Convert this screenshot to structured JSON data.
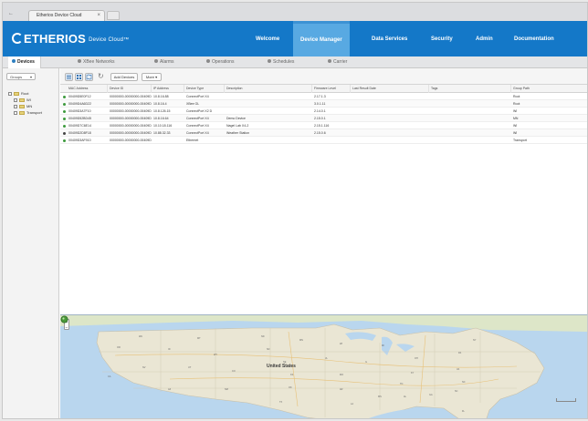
{
  "browser": {
    "tab_title": "Etherios Device Cloud",
    "tab_close": "×",
    "back_glyph": "←"
  },
  "header": {
    "brand": "ETHERIOS",
    "product": "Device Cloud",
    "trademark": "™",
    "nav": [
      {
        "label": "Welcome"
      },
      {
        "label": "Device Manager",
        "active": true
      },
      {
        "label": "Data Services"
      },
      {
        "label": "Security"
      },
      {
        "label": "Admin"
      },
      {
        "label": "Documentation"
      }
    ]
  },
  "subtabs": [
    {
      "label": "Devices",
      "active": true
    },
    {
      "label": "XBee Networks"
    },
    {
      "label": "Alarms"
    },
    {
      "label": "Operations"
    },
    {
      "label": "Schedules"
    },
    {
      "label": "Carrier"
    }
  ],
  "sidebar": {
    "group_select": "Groups",
    "tree": [
      {
        "label": "Root",
        "level": 0
      },
      {
        "label": "WI",
        "level": 1
      },
      {
        "label": "MN",
        "level": 1
      },
      {
        "label": "Transport",
        "level": 1
      }
    ]
  },
  "toolbar": {
    "add_devices": "Add Devices",
    "more": "More",
    "more_caret": "▾",
    "refresh_glyph": "↻"
  },
  "table": {
    "columns": [
      "MAC Address",
      "Device ID",
      "IP Address",
      "Device Type",
      "Description",
      "Firmware Level",
      "Last Result Date",
      "Tags",
      "Group Path"
    ],
    "rows": [
      {
        "status": "connected",
        "mac": "00409D5E0F12",
        "id": "00000000-00000000-00409DFF-FF5E0F12",
        "ip": "10.8.16.88",
        "type": "ConnectPort X4",
        "desc": "",
        "fw": "2.17.1.3",
        "last": "",
        "tags": "",
        "group": "Root"
      },
      {
        "status": "connected",
        "mac": "00409D4A6D22",
        "id": "00000000-00000000-00409DFF-FF4A6D22",
        "ip": "10.8.16.4",
        "type": "XBee GL",
        "desc": "",
        "fw": "3.0.1.11",
        "last": "",
        "tags": "",
        "group": "Root"
      },
      {
        "status": "connected",
        "mac": "00409D3A7F10",
        "id": "00000000-00000000-00409DFF-FF3A7F10",
        "ip": "10.8.126.15",
        "type": "ConnectPort X2 D",
        "desc": "",
        "fw": "2.14.0.1",
        "last": "",
        "tags": "",
        "group": "WI"
      },
      {
        "status": "connected",
        "mac": "00409D52BD45",
        "id": "00000000-00000000-00409DFF-FF52BD45",
        "ip": "10.8.16.64",
        "type": "ConnectPort X4",
        "desc": "Demo Device",
        "fw": "2.15.0.1",
        "last": "",
        "tags": "",
        "group": "MN"
      },
      {
        "status": "connected",
        "mac": "00409D7C6E14",
        "id": "00000000-00000000-00409DFF-FF7C6E14",
        "ip": "10.10.18.116",
        "type": "ConnectPort X4",
        "desc": "Nagel Lab X4-2",
        "fw": "2.15.1.116",
        "last": "",
        "tags": "",
        "group": "WI"
      },
      {
        "status": "disconnected",
        "mac": "00409D2D8F18",
        "id": "00000000-00000000-00409DFF-FF2D8F18",
        "ip": "10.88.32.33",
        "type": "ConnectPort X4",
        "desc": "Weather Station",
        "fw": "2.15.0.6",
        "last": "",
        "tags": "",
        "group": "WI"
      },
      {
        "status": "connected",
        "mac": "00409D3AF910",
        "id": "00000000-00000000-00409DFF-FF3AF910",
        "ip": "",
        "type": "Ethernet",
        "desc": "",
        "fw": "",
        "last": "",
        "tags": "",
        "group": "Transport"
      }
    ]
  },
  "map": {
    "country_label": "United States",
    "zoom_in": "+",
    "zoom_out": "−",
    "states": [
      "WA",
      "MT",
      "ND",
      "MN",
      "WI",
      "MI",
      "NY",
      "OR",
      "ID",
      "WY",
      "SD",
      "IA",
      "IL",
      "OH",
      "PA",
      "NV",
      "UT",
      "CO",
      "NE",
      "KS",
      "MO",
      "KY",
      "VA",
      "CA",
      "AZ",
      "NM",
      "OK",
      "AR",
      "TN",
      "NC",
      "TX",
      "LA",
      "MS",
      "AL",
      "GA",
      "SC",
      "FL"
    ]
  }
}
